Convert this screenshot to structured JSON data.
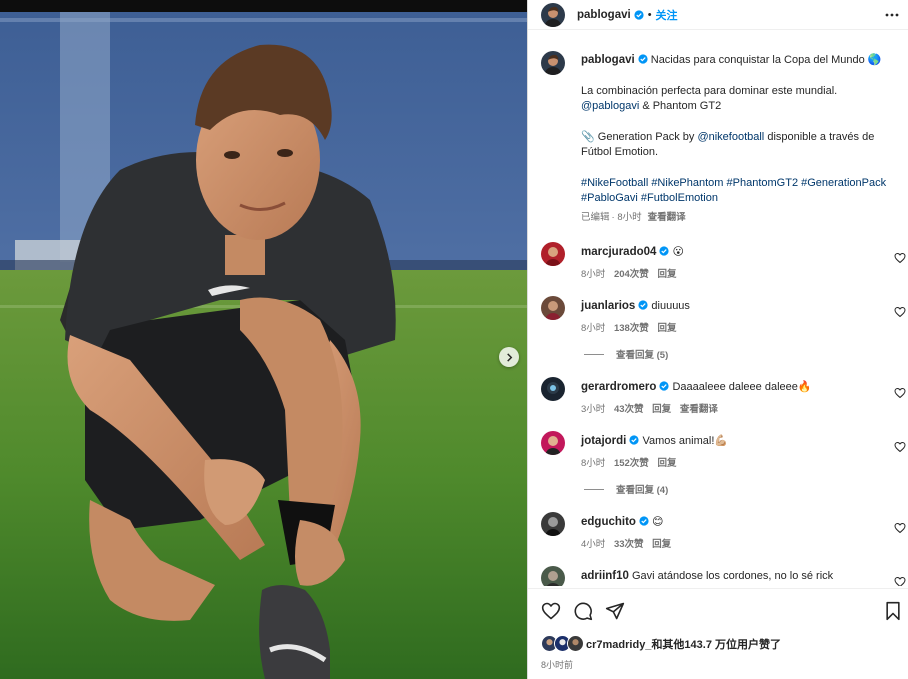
{
  "header": {
    "username": "pablogavi",
    "separator": "•",
    "follow_label": "关注"
  },
  "caption": {
    "username": "pablogavi",
    "line1": "Nacidas para conquistar la Copa del Mundo",
    "emoji1": "🌎",
    "line2": "La combinación perfecta para dominar este mundial.",
    "mention1": "@pablogavi",
    "line3_rest": " & Phantom GT2",
    "line4_emoji": "📎",
    "line4_pre": "Generation Pack by ",
    "mention2": "@nikefootball",
    "line4_post": " disponible a través de",
    "line5": "Fútbol Emotion.",
    "hashtags_line1": "#NikeFootball #NikePhantom #PhantomGT2 #GenerationPack",
    "hashtags_line2": "#PabloGavi #FutbolEmotion",
    "edited": "已编辑",
    "time": "· 8小时",
    "translate": "查看翻译"
  },
  "comments": [
    {
      "username": "marcjurado04",
      "text": "😮",
      "time": "8小时",
      "likes": "204次赞",
      "reply": "回复",
      "translate": ""
    },
    {
      "username": "juanlarios",
      "text": "diuuuus",
      "time": "8小时",
      "likes": "138次赞",
      "reply": "回复",
      "translate": "",
      "view_replies": "查看回复 (5)"
    },
    {
      "username": "gerardromero",
      "text": "Daaaaleee daleee daleee🔥",
      "time": "3小时",
      "likes": "43次赞",
      "reply": "回复",
      "translate": "查看翻译"
    },
    {
      "username": "jotajordi",
      "text": "Vamos animal!💪🏼",
      "time": "8小时",
      "likes": "152次赞",
      "reply": "回复",
      "translate": "",
      "view_replies": "查看回复 (4)"
    },
    {
      "username": "edguchito",
      "text": "😊",
      "time": "4小时",
      "likes": "33次赞",
      "reply": "回复",
      "translate": ""
    },
    {
      "username": "adriinf10",
      "text": "Gavi atándose los cordones, no lo sé rick",
      "time": "",
      "likes": "",
      "reply": "",
      "translate": ""
    }
  ],
  "likes": {
    "user": "cr7madridy_",
    "rest": "和其他143.7 万位用户赞了"
  },
  "time_ago": "8小时前",
  "icons": {
    "verified": "verified-badge-icon",
    "more": "more-options-icon",
    "like": "heart-icon",
    "comment": "comment-bubble-icon",
    "share": "paper-plane-icon",
    "save": "bookmark-icon",
    "next": "chevron-right-icon"
  },
  "colors": {
    "accent": "#0095f6",
    "verified": "#0095f6",
    "link": "#00376b",
    "meta": "#737373"
  }
}
